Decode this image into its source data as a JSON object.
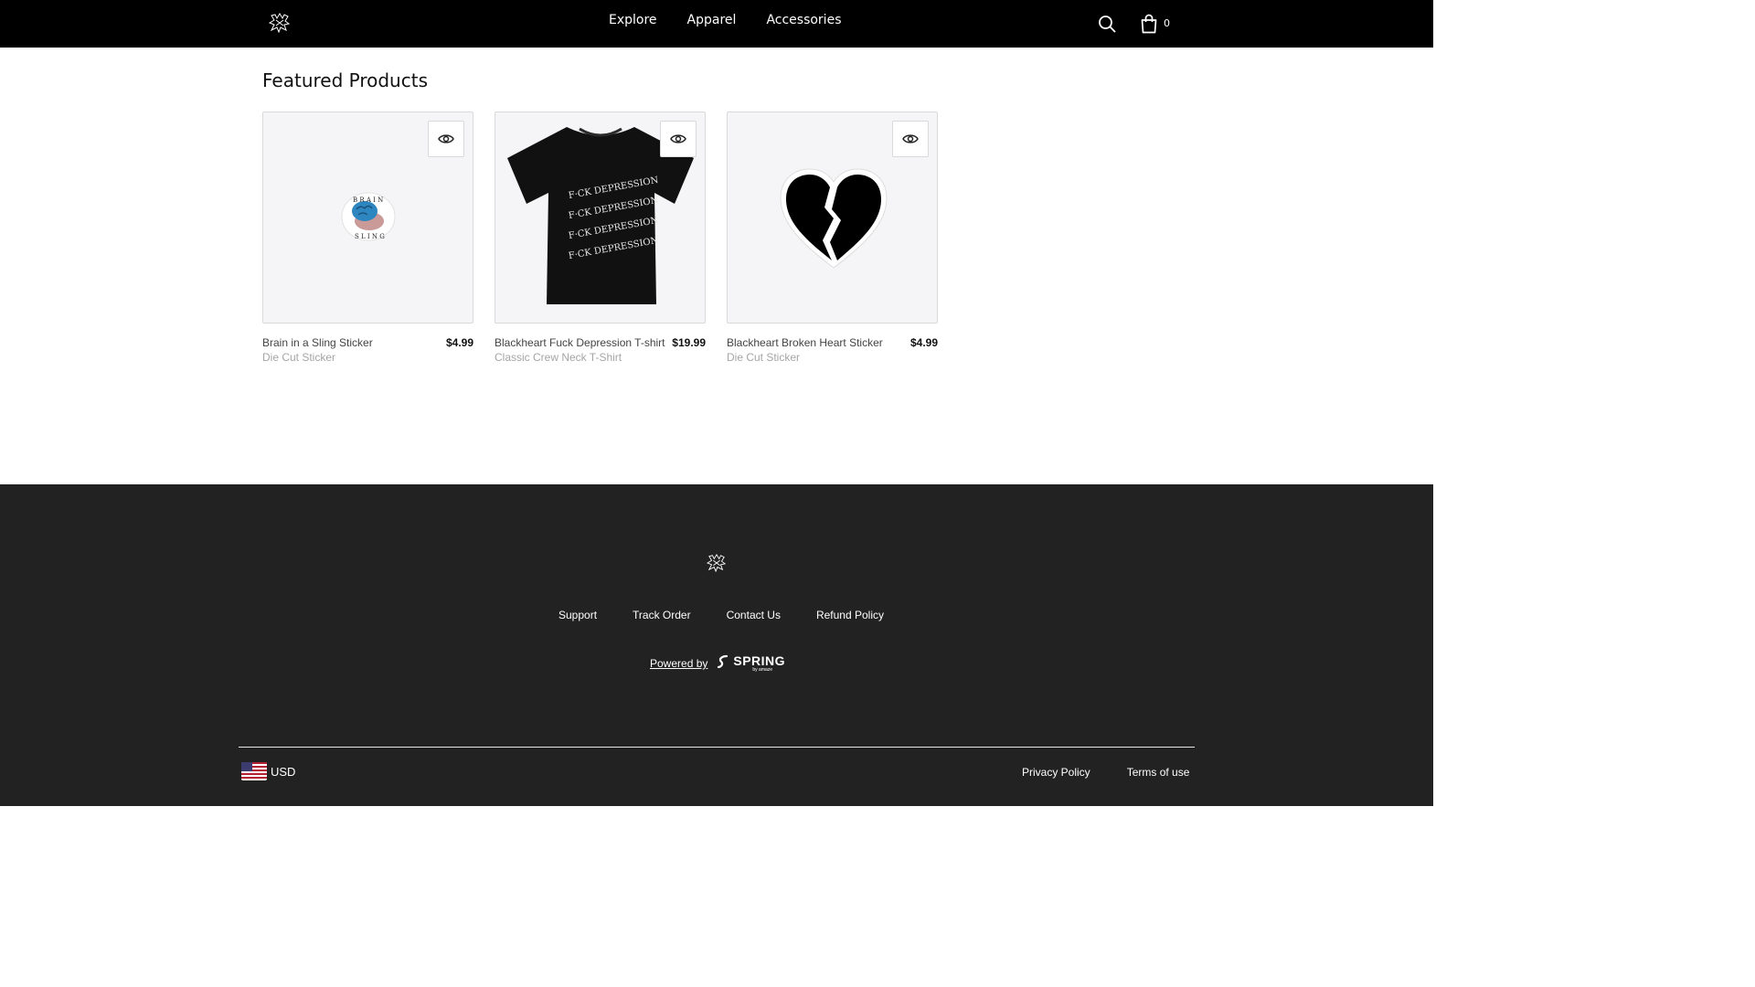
{
  "header": {
    "nav": [
      "Explore",
      "Apparel",
      "Accessories"
    ],
    "cart_count": "0",
    "icons": [
      "brand-logo",
      "search-icon",
      "shopping-bag-icon"
    ]
  },
  "main": {
    "section_title": "Featured Products",
    "products": [
      {
        "name": "Brain in a Sling Sticker",
        "price": "$4.99",
        "subtitle": "Die Cut Sticker",
        "image": "brain-sticker-image"
      },
      {
        "name": "Blackheart Fuck Depression T-shirt",
        "price": "$19.99",
        "subtitle": "Classic Crew Neck T-Shirt",
        "image": "black-tshirt-image"
      },
      {
        "name": "Blackheart Broken Heart Sticker",
        "price": "$4.99",
        "subtitle": "Die Cut Sticker",
        "image": "broken-heart-sticker-image"
      }
    ]
  },
  "footer": {
    "links": [
      "Support",
      "Track Order",
      "Contact Us",
      "Refund Policy"
    ],
    "powered_by": "Powered by",
    "spring_word": "SPRING",
    "spring_by": "by amaze",
    "currency": "USD",
    "legal": [
      "Privacy Policy",
      "Terms of use"
    ]
  },
  "colors": {
    "header_bg": "#000000",
    "footer_bg": "#222222",
    "card_bg": "#f5f5f7",
    "subtitle_text": "#a5a5a8"
  }
}
